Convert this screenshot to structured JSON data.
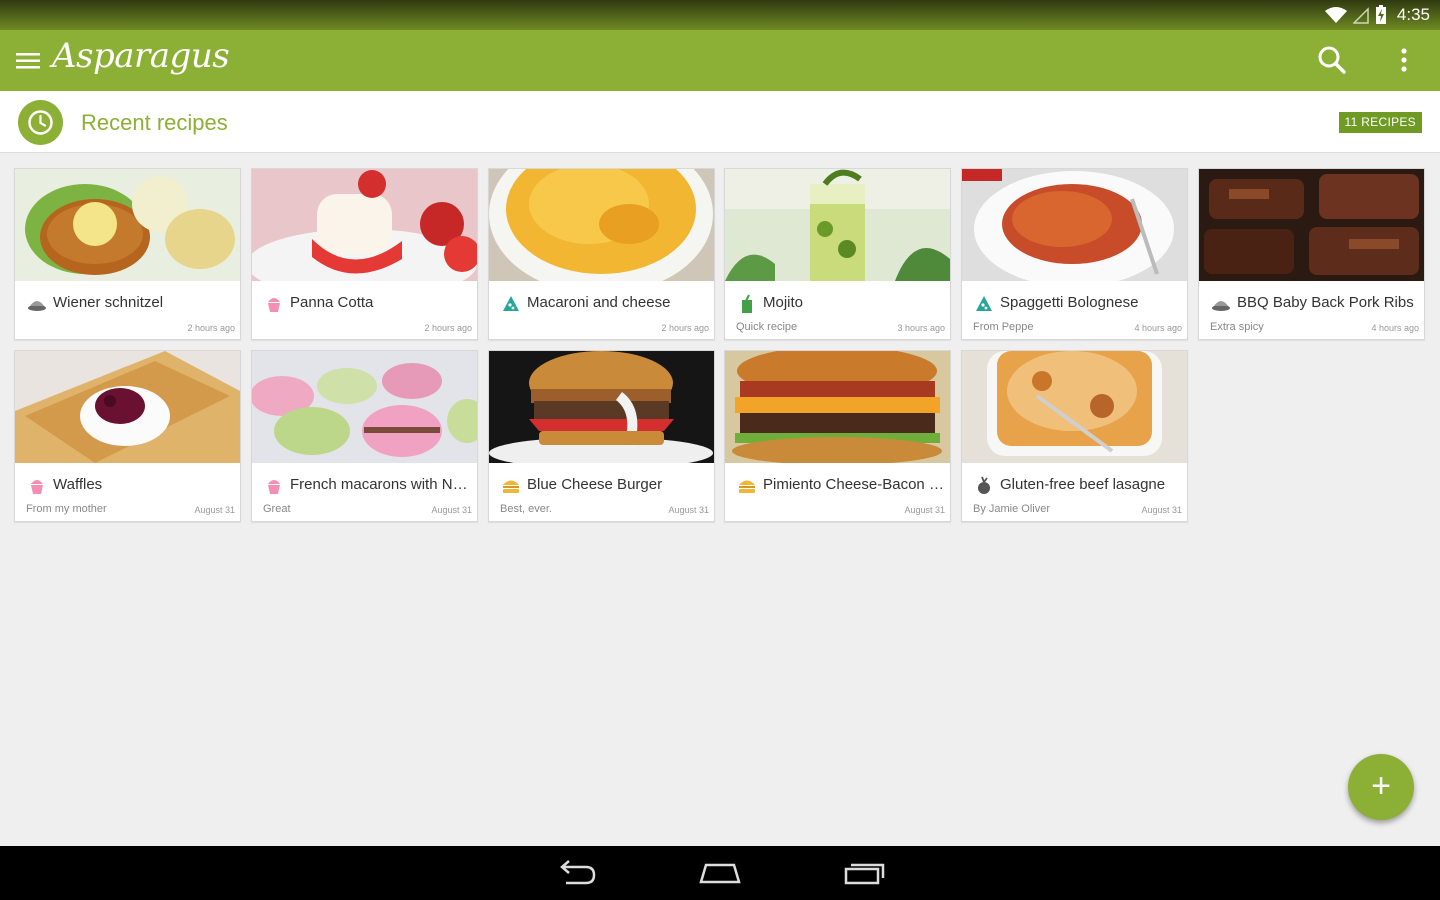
{
  "status": {
    "time": "4:35"
  },
  "app": {
    "title": "Asparagus"
  },
  "section": {
    "title": "Recent recipes",
    "count": "11 RECIPES"
  },
  "colors": {
    "primary": "#8cb035",
    "badge": "#6f9a24"
  },
  "recipes": [
    {
      "title": "Wiener schnitzel",
      "subtitle": "",
      "time": "2 hours ago",
      "icon": "roast-dish-icon"
    },
    {
      "title": "Panna Cotta",
      "subtitle": "",
      "time": "2 hours ago",
      "icon": "cupcake-icon"
    },
    {
      "title": "Macaroni and cheese",
      "subtitle": "",
      "time": "2 hours ago",
      "icon": "pizza-slice-icon"
    },
    {
      "title": "Mojito",
      "subtitle": "Quick recipe",
      "time": "3 hours ago",
      "icon": "cocktail-icon"
    },
    {
      "title": "Spaggetti Bolognese",
      "subtitle": "From Peppe",
      "time": "4 hours ago",
      "icon": "pizza-slice-icon"
    },
    {
      "title": "BBQ Baby Back Pork Ribs",
      "subtitle": "Extra spicy",
      "time": "4 hours ago",
      "icon": "roast-dish-icon"
    },
    {
      "title": "Waffles",
      "subtitle": "From my mother",
      "time": "August 31",
      "icon": "cupcake-icon"
    },
    {
      "title": "French macarons with Nutella",
      "subtitle": "Great",
      "time": "August 31",
      "icon": "cupcake-icon"
    },
    {
      "title": "Blue Cheese Burger",
      "subtitle": "Best, ever.",
      "time": "August 31",
      "icon": "burger-icon"
    },
    {
      "title": "Pimiento Cheese-Bacon Burg...",
      "subtitle": "",
      "time": "August 31",
      "icon": "burger-icon"
    },
    {
      "title": "Gluten-free beef lasagne",
      "subtitle": "By Jamie Oliver",
      "time": "August 31",
      "icon": "beet-icon"
    }
  ],
  "fab": {
    "label": "+"
  }
}
